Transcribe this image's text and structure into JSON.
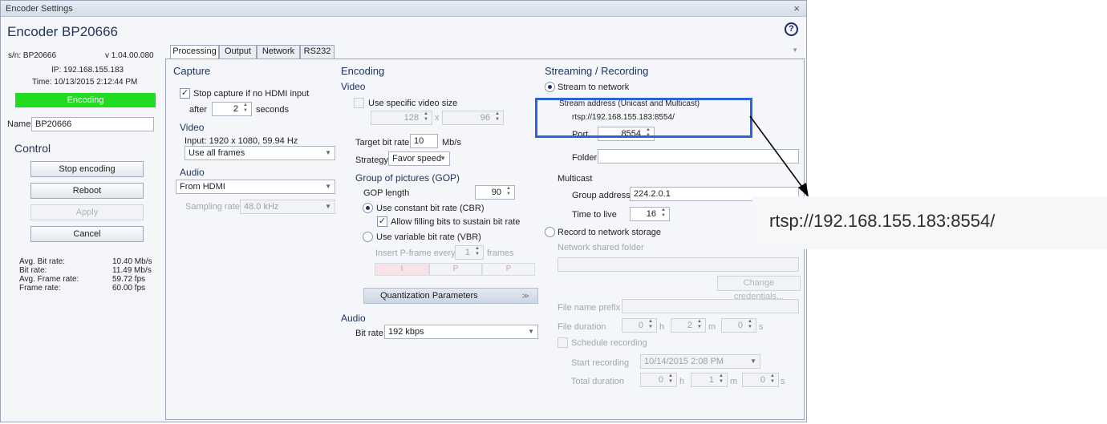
{
  "window": {
    "title": "Encoder Settings",
    "close": "×"
  },
  "header": {
    "title": "Encoder BP20666",
    "help": "?"
  },
  "device": {
    "sn": "s/n: BP20666",
    "version": "v 1.04.00.080",
    "ip": "IP: 192.168.155.183",
    "time": "Time: 10/13/2015 2:12:44 PM",
    "status": "Encoding",
    "name_label": "Name",
    "name_value": "BP20666"
  },
  "control": {
    "title": "Control",
    "stop": "Stop encoding",
    "reboot": "Reboot",
    "apply": "Apply",
    "cancel": "Cancel"
  },
  "stats": [
    {
      "label": "Avg. Bit rate:",
      "value": "10.40 Mb/s"
    },
    {
      "label": "Bit rate:",
      "value": "11.49 Mb/s"
    },
    {
      "label": "Avg. Frame rate:",
      "value": "59.72 fps"
    },
    {
      "label": "Frame rate:",
      "value": "60.00 fps"
    }
  ],
  "tabs": [
    "Processing",
    "Output",
    "Network",
    "RS232"
  ],
  "capture": {
    "title": "Capture",
    "stop_label": "Stop capture if no HDMI input",
    "after": "after",
    "seconds_value": "2",
    "seconds": "seconds",
    "video_title": "Video",
    "input": "Input: 1920 x 1080, 59.94 Hz",
    "frames": "Use all frames",
    "audio_title": "Audio",
    "audio_source": "From HDMI",
    "sampling_label": "Sampling rate",
    "sampling_value": "48.0 kHz"
  },
  "encoding": {
    "title": "Encoding",
    "video_title": "Video",
    "specific_size": "Use specific video size",
    "width": "128",
    "x": "x",
    "height": "96",
    "target_label": "Target bit rate",
    "target_value": "10",
    "target_unit": "Mb/s",
    "strategy_label": "Strategy",
    "strategy_value": "Favor speed",
    "gop_title": "Group of pictures (GOP)",
    "gop_length_label": "GOP length",
    "gop_length_value": "90",
    "cbr": "Use constant bit rate (CBR)",
    "fill_bits": "Allow filling bits to sustain bit rate",
    "vbr": "Use variable bit rate (VBR)",
    "pframe_label": "Insert P-frame every",
    "pframe_value": "1",
    "pframe_unit": "frames",
    "gop_i": "I",
    "gop_p1": "P",
    "gop_p2": "P",
    "quant": "Quantization Parameters",
    "quant_chev": "»",
    "audio_title": "Audio",
    "bitrate_label": "Bit rate",
    "bitrate_value": "192 kbps"
  },
  "streaming": {
    "title": "Streaming / Recording",
    "stream_network": "Stream to network",
    "address_label": "Stream address (Unicast and Multicast)",
    "address": "rtsp://192.168.155.183:8554/",
    "port_label": "Port",
    "port_value": "8554",
    "folder_label": "Folder",
    "multicast_title": "Multicast",
    "group_label": "Group address",
    "group_value": "224.2.0.1",
    "ttl_label": "Time to live",
    "ttl_value": "16",
    "record_label": "Record to network storage",
    "shared_folder": "Network shared folder",
    "change_credentials": "Change credentials...",
    "prefix_label": "File name prefix",
    "duration_label": "File duration",
    "dur_h": "0",
    "dur_m": "2",
    "dur_s": "0",
    "unit_h": "h",
    "unit_m": "m",
    "unit_s": "s",
    "schedule": "Schedule recording",
    "start_label": "Start recording",
    "start_value": "10/14/2015 2:08 PM",
    "total_label": "Total duration",
    "tot_h": "0",
    "tot_m": "1",
    "tot_s": "0"
  },
  "zoom": {
    "text": "rtsp://192.168.155.183:8554/"
  },
  "colors": {
    "status": "#20dc20",
    "highlight": "#2a62e0",
    "title": "#20355c"
  }
}
